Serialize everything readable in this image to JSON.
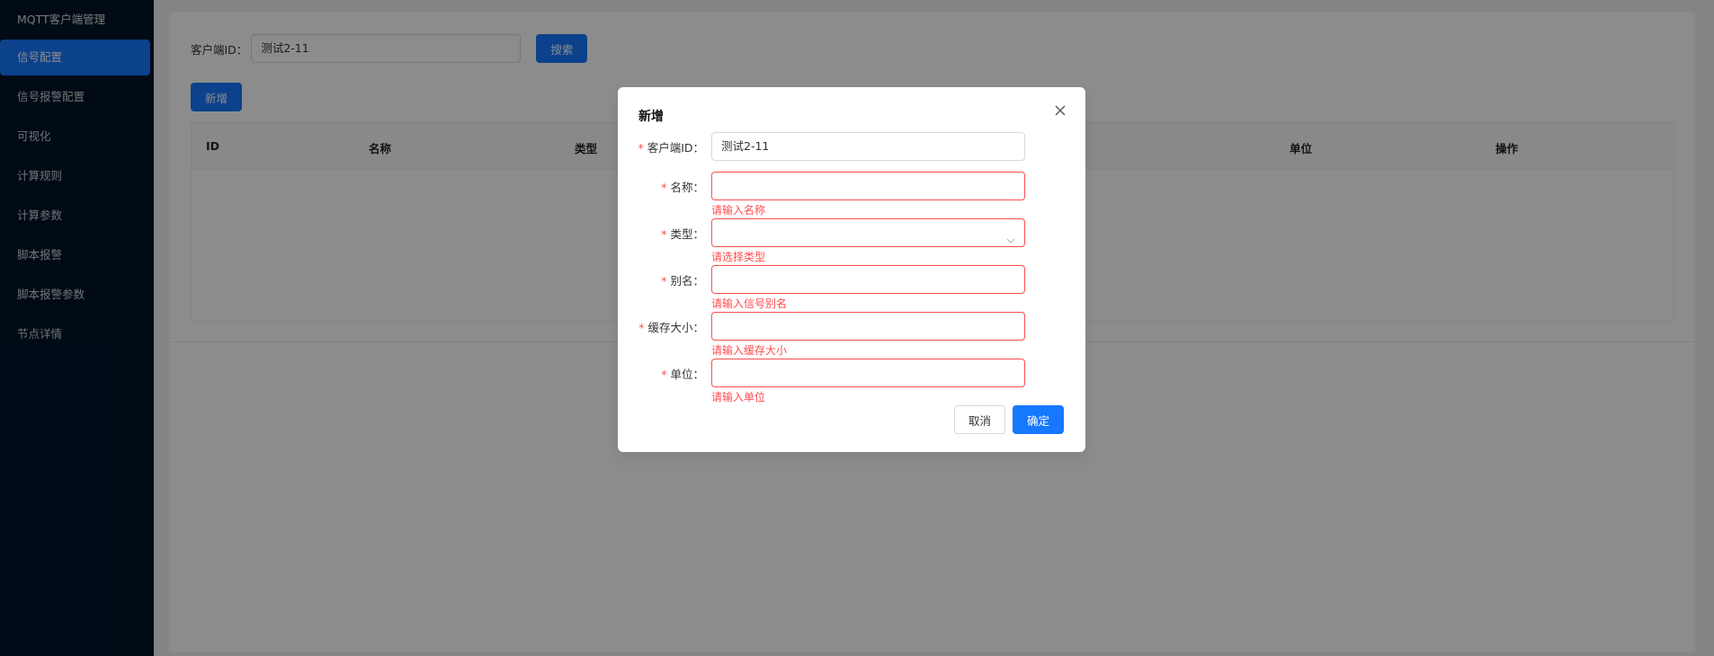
{
  "sidebar": {
    "brand": "MQTT客户端管理",
    "items": [
      {
        "label": "信号配置",
        "active": true
      },
      {
        "label": "信号报警配置"
      },
      {
        "label": "可视化"
      },
      {
        "label": "计算规则"
      },
      {
        "label": "计算参数"
      },
      {
        "label": "脚本报警"
      },
      {
        "label": "脚本报警参数"
      },
      {
        "label": "节点详情"
      }
    ]
  },
  "search": {
    "label": "客户端ID：",
    "value": "测试2-11",
    "button": "搜索"
  },
  "toolbar": {
    "add_label": "新增"
  },
  "table": {
    "columns": [
      "ID",
      "名称",
      "类型",
      "单位",
      "操作"
    ]
  },
  "modal": {
    "title": "新增",
    "fields": [
      {
        "label": "客户端ID：",
        "value": "测试2-11",
        "error": ""
      },
      {
        "label": "名称：",
        "value": "",
        "error": "请输入名称"
      },
      {
        "label": "类型：",
        "value": "",
        "error": "请选择类型"
      },
      {
        "label": "别名：",
        "value": "",
        "error": "请输入信号别名"
      },
      {
        "label": "缓存大小：",
        "value": "",
        "error": "请输入缓存大小"
      },
      {
        "label": "单位：",
        "value": "",
        "error": "请输入单位"
      }
    ],
    "cancel": "取消",
    "ok": "确定"
  },
  "colors": {
    "sidebar_bg": "#001529",
    "primary": "#1677ff",
    "error": "#ff4d4f"
  }
}
